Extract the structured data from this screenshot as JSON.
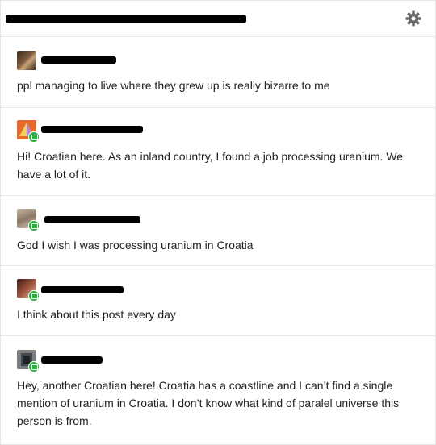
{
  "header": {
    "settings_icon": "gear-icon"
  },
  "posts": [
    {
      "text": "ppl managing to live where they grew up is really bizarre to me"
    },
    {
      "text": "Hi! Croatian here. As an inland country, I found a job processing uranium. We have a lot of it."
    },
    {
      "text": "God I wish I was processing uranium in Croatia"
    },
    {
      "text": "I think about this post every day"
    },
    {
      "text": "Hey, another Croatian here! Croatia has a coastline and I can’t find a single mention of uranium in Croatia. I don’t know what kind of paralel universe this person is from."
    }
  ],
  "colors": {
    "badge_green": "#27b03b",
    "divider": "#e9e9e9",
    "text": "#222222"
  }
}
